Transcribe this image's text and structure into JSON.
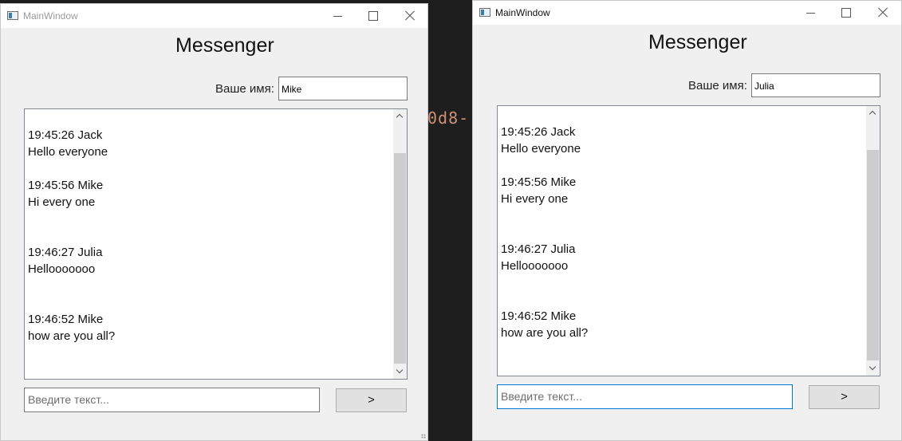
{
  "background_code_text": "0d8-",
  "windows": [
    {
      "title": "MainWindow",
      "heading": "Messenger",
      "name_label": "Ваше имя:",
      "name_value": "Mike",
      "messages": [
        {
          "header": "19:45:26 Jack",
          "text": "Hello everyone"
        },
        {
          "header": "19:45:56 Mike",
          "text": "Hi every one"
        },
        {
          "header": "19:46:27 Julia",
          "text": "Hellooooooo"
        },
        {
          "header": "19:46:52 Mike",
          "text": "how are you all?"
        }
      ],
      "message_placeholder": "Введите текст...",
      "send_label": ">"
    },
    {
      "title": "MainWindow",
      "heading": "Messenger",
      "name_label": "Ваше имя:",
      "name_value": "Julia",
      "messages": [
        {
          "header": "19:45:26 Jack",
          "text": "Hello everyone"
        },
        {
          "header": "19:45:56 Mike",
          "text": "Hi every one"
        },
        {
          "header": "19:46:27 Julia",
          "text": "Hellooooooo"
        },
        {
          "header": "19:46:52 Mike",
          "text": "how are you all?"
        }
      ],
      "message_placeholder": "Введите текст...",
      "send_label": ">"
    }
  ]
}
